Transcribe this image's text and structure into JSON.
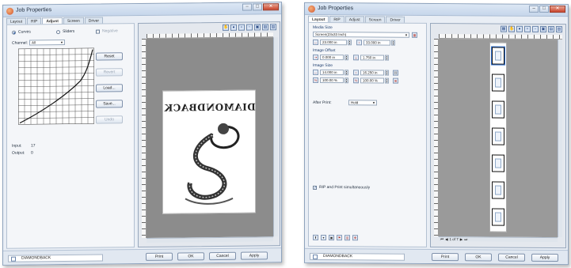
{
  "win1": {
    "title": "Job Properties",
    "tabs": [
      "Layout",
      "RIP",
      "Adjust",
      "Screen",
      "Driver"
    ],
    "active_tab": "Adjust",
    "radio_curves": "Curves",
    "radio_sliders": "Sliders",
    "check_negative": "Negative",
    "channel_label": "Channel:",
    "channel_value": "All",
    "buttons": [
      "Reset",
      "Revert",
      "Load...",
      "Save...",
      "Undo"
    ],
    "input_label": "Input:",
    "input_value": "17",
    "output_label": "Output:",
    "output_value": "0",
    "preview_text": "DIAMONDBACK",
    "job_name": "DIAMONDBACK",
    "footer_buttons": [
      "Print",
      "OK",
      "Cancel",
      "Apply"
    ]
  },
  "win2": {
    "title": "Job Properties",
    "tabs": [
      "Layout",
      "RIP",
      "Adjust",
      "Screen",
      "Driver"
    ],
    "active_tab": "Layout",
    "media_size_label": "Media Size",
    "media_size_value": "Screen(23x33 Inch)",
    "media_w": "23.000 in",
    "media_h": "33.000 in",
    "offset_label": "Image Offset",
    "offset_x": "0.000 in",
    "offset_y": "1.750 in",
    "image_size_label": "Image Size",
    "size_w": "14.000 in",
    "size_h": "16.250 in",
    "scale_x": "100.00 %",
    "scale_y": "100.00 %",
    "after_print_label": "After Print:",
    "after_print_value": "Hold",
    "rip_print_label": "RIP and Print simultaneously",
    "page_nav": "1 of 7",
    "job_name": "DIAMONDBACK",
    "footer_buttons": [
      "Print",
      "OK",
      "Cancel",
      "Apply"
    ]
  }
}
